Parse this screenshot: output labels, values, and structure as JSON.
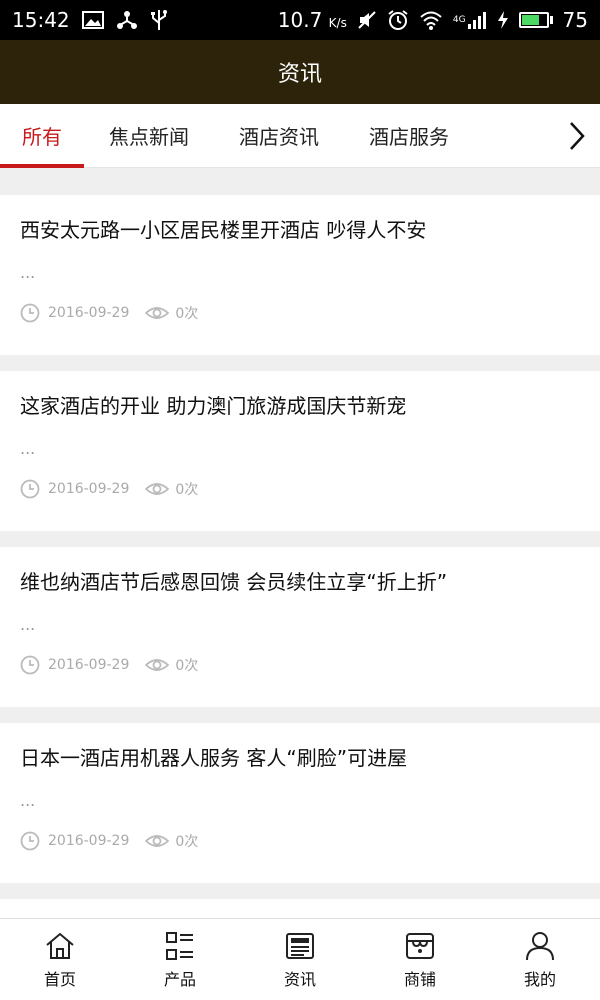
{
  "status_bar": {
    "time": "15:42",
    "speed": "10.7",
    "speed_unit": "K/s",
    "signal_label": "4G",
    "battery": "75",
    "battery_level": 0.75
  },
  "header": {
    "title": "资讯"
  },
  "tabs": [
    {
      "label": "所有",
      "active": true
    },
    {
      "label": "焦点新闻",
      "active": false
    },
    {
      "label": "酒店资讯",
      "active": false
    },
    {
      "label": "酒店服务",
      "active": false
    }
  ],
  "articles": [
    {
      "title": "西安太元路一小区居民楼里开酒店 吵得人不安",
      "desc": "...",
      "date": "2016-09-29",
      "views": "0次"
    },
    {
      "title": "这家酒店的开业 助力澳门旅游成国庆节新宠",
      "desc": "...",
      "date": "2016-09-29",
      "views": "0次"
    },
    {
      "title": "维也纳酒店节后感恩回馈 会员续住立享“折上折”",
      "desc": "...",
      "date": "2016-09-29",
      "views": "0次"
    },
    {
      "title": "日本一酒店用机器人服务 客人“刷脸”可进屋",
      "desc": "...",
      "date": "2016-09-29",
      "views": "0次"
    }
  ],
  "bottom_nav": [
    {
      "label": "首页",
      "icon": "home-icon"
    },
    {
      "label": "产品",
      "icon": "grid-list-icon"
    },
    {
      "label": "资讯",
      "icon": "news-icon"
    },
    {
      "label": "商铺",
      "icon": "store-icon"
    },
    {
      "label": "我的",
      "icon": "user-icon"
    }
  ],
  "colors": {
    "header_bg": "#2c230a",
    "accent": "#c81a1a",
    "meta_gray": "#aaaaaa"
  }
}
